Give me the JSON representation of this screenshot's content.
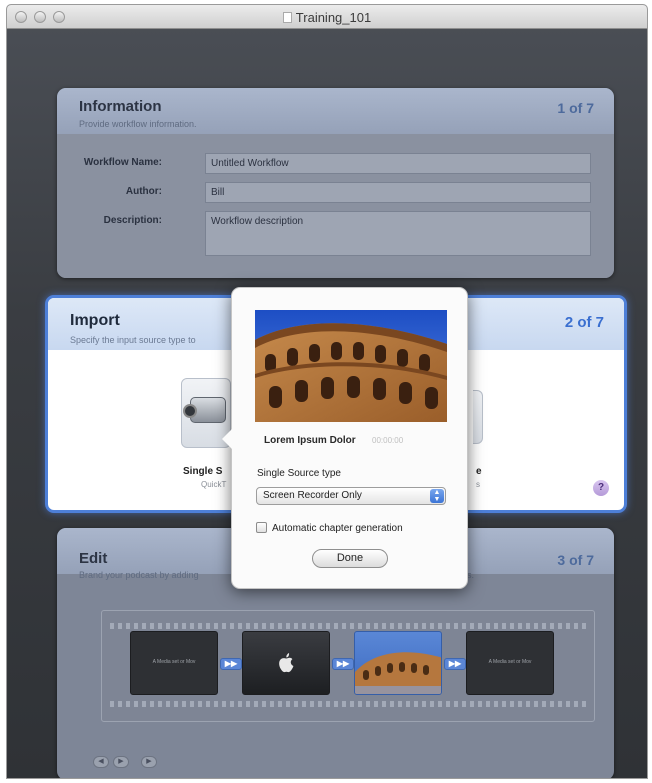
{
  "window": {
    "title": "Training_101"
  },
  "information": {
    "title": "Information",
    "subtitle": "Provide workflow information.",
    "step": "1 of 7",
    "fields": {
      "workflow_name_label": "Workflow Name:",
      "workflow_name_value": "Untitled Workflow",
      "author_label": "Author:",
      "author_value": "Bill",
      "description_label": "Description:",
      "description_value": "Workflow description"
    }
  },
  "import": {
    "title": "Import",
    "subtitle": "Specify the input source type to",
    "step": "2 of 7",
    "tile_label": "Single S",
    "tile_sub": "QuickT",
    "tile2_label": "e",
    "tile2_sub": "s",
    "help": "?"
  },
  "edit": {
    "title": "Edit",
    "subtitle": "Brand your podcast by adding",
    "subtitle_tail": "s.",
    "step": "3 of 7",
    "clips": [
      "A Media set or Mov",
      "",
      "",
      "A Media set or Mov"
    ]
  },
  "popover": {
    "photo_caption": "Lorem Ipsum Dolor",
    "photo_sub": "00:00:00",
    "source_type_label": "Single Source type",
    "source_type_value": "Screen Recorder Only",
    "chapter_label": "Automatic chapter generation",
    "chapter_checked": false,
    "done_label": "Done"
  }
}
